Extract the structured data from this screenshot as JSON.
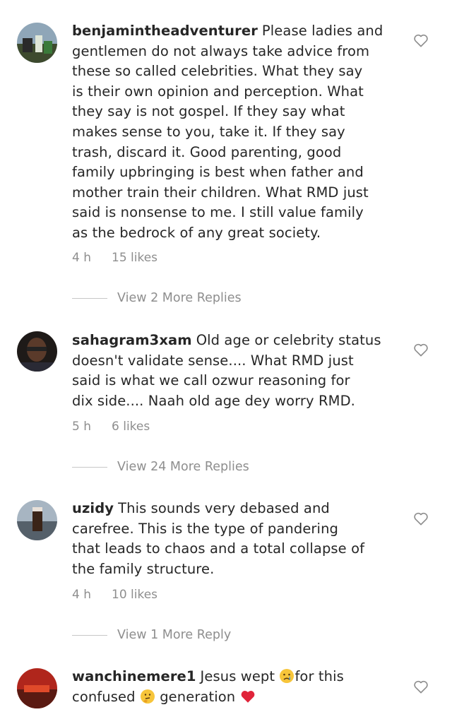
{
  "comments": [
    {
      "username": "benjamintheadventurer",
      "lines": [
        "Please ladies and",
        "gentlemen do not always take advice from",
        "these so called celebrities. What they say",
        "is their own opinion and perception. What",
        "they say is not gospel. If they say what",
        "makes sense to you, take it. If they say",
        "trash, discard it. Good parenting, good",
        "family upbringing is best when father and",
        "mother train their children. What RMD just",
        "said is nonsense to me. I still value family",
        "as the bedrock of any great society."
      ],
      "time": "4 h",
      "likes": "15 likes",
      "replies": "View 2 More Replies",
      "avatar_color": "#4a5a3a"
    },
    {
      "username": "sahagram3xam",
      "lines": [
        "Old age or celebrity status",
        "doesn't validate sense.... What RMD just",
        "said is what we call  ozwur reasoning for",
        "dix side.... Naah old age dey worry RMD."
      ],
      "time": "5 h",
      "likes": "6 likes",
      "replies": "View 24 More Replies",
      "avatar_color": "#3a2a22"
    },
    {
      "username": "uzidy",
      "lines": [
        "This sounds very debased and",
        "carefree. This is the type of pandering",
        "that leads to chaos and a total collapse of",
        "the family structure."
      ],
      "time": "4 h",
      "likes": "10 likes",
      "replies": "View 1 More Reply",
      "avatar_color": "#6b7b8a"
    },
    {
      "username": "wanchinemere1",
      "line1_a": "Jesus wept",
      "line1_b": "for this",
      "line2_a": "confused",
      "line2_b": "generation",
      "avatar_color": "#b0261c"
    }
  ],
  "icons": {
    "heart": "heart-outline-icon",
    "emoji_cry": "crying-face-emoji",
    "emoji_think": "thinking-face-emoji",
    "emoji_heart": "red-heart-emoji"
  },
  "colors": {
    "text": "#262626",
    "secondary": "#8e8e8e",
    "divider": "#c7c7c7"
  }
}
